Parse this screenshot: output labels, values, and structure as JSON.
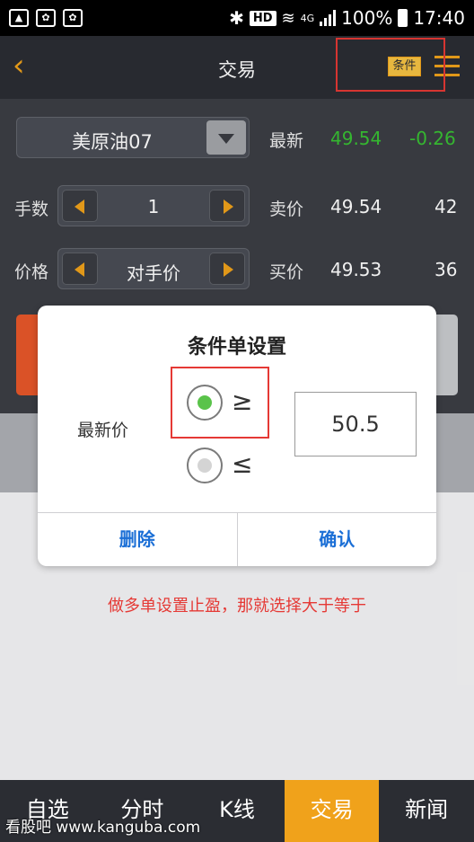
{
  "status_bar": {
    "left_icons": [
      "image-icon",
      "paw-icon",
      "paw-icon"
    ],
    "hd": "HD",
    "network": "4G",
    "battery": "100%",
    "time": "17:40"
  },
  "header": {
    "back_icon": "chevron-left-icon",
    "title": "交易",
    "condition_label": "条件",
    "menu_icon": "hamburger-icon"
  },
  "trade": {
    "symbol": "美原油07",
    "latest_label": "最新",
    "latest_price": "49.54",
    "latest_change": "-0.26",
    "qty_label": "手数",
    "qty_value": "1",
    "sell_label": "卖价",
    "sell_price": "49.54",
    "sell_volume": "42",
    "price_label": "价格",
    "price_mode": "对手价",
    "buy_label": "买价",
    "buy_price": "49.53",
    "buy_volume": "36"
  },
  "dialog": {
    "title": "条件单设置",
    "field_label": "最新价",
    "option_ge": "≥",
    "option_le": "≤",
    "selected": "≥",
    "price_value": "50.5",
    "delete_label": "删除",
    "confirm_label": "确认"
  },
  "hint": "做多单设置止盈，那就选择大于等于",
  "bottom_nav": [
    "自选",
    "分时",
    "K线",
    "交易",
    "新闻"
  ],
  "bottom_nav_active": "交易",
  "watermark": "看股吧 www.kanguba.com",
  "colors": {
    "accent": "#f0a21b",
    "up_green": "#39c234",
    "down_green": "#39c234",
    "annotation_red": "#e53935",
    "dialog_button_blue": "#1b6fd6"
  }
}
